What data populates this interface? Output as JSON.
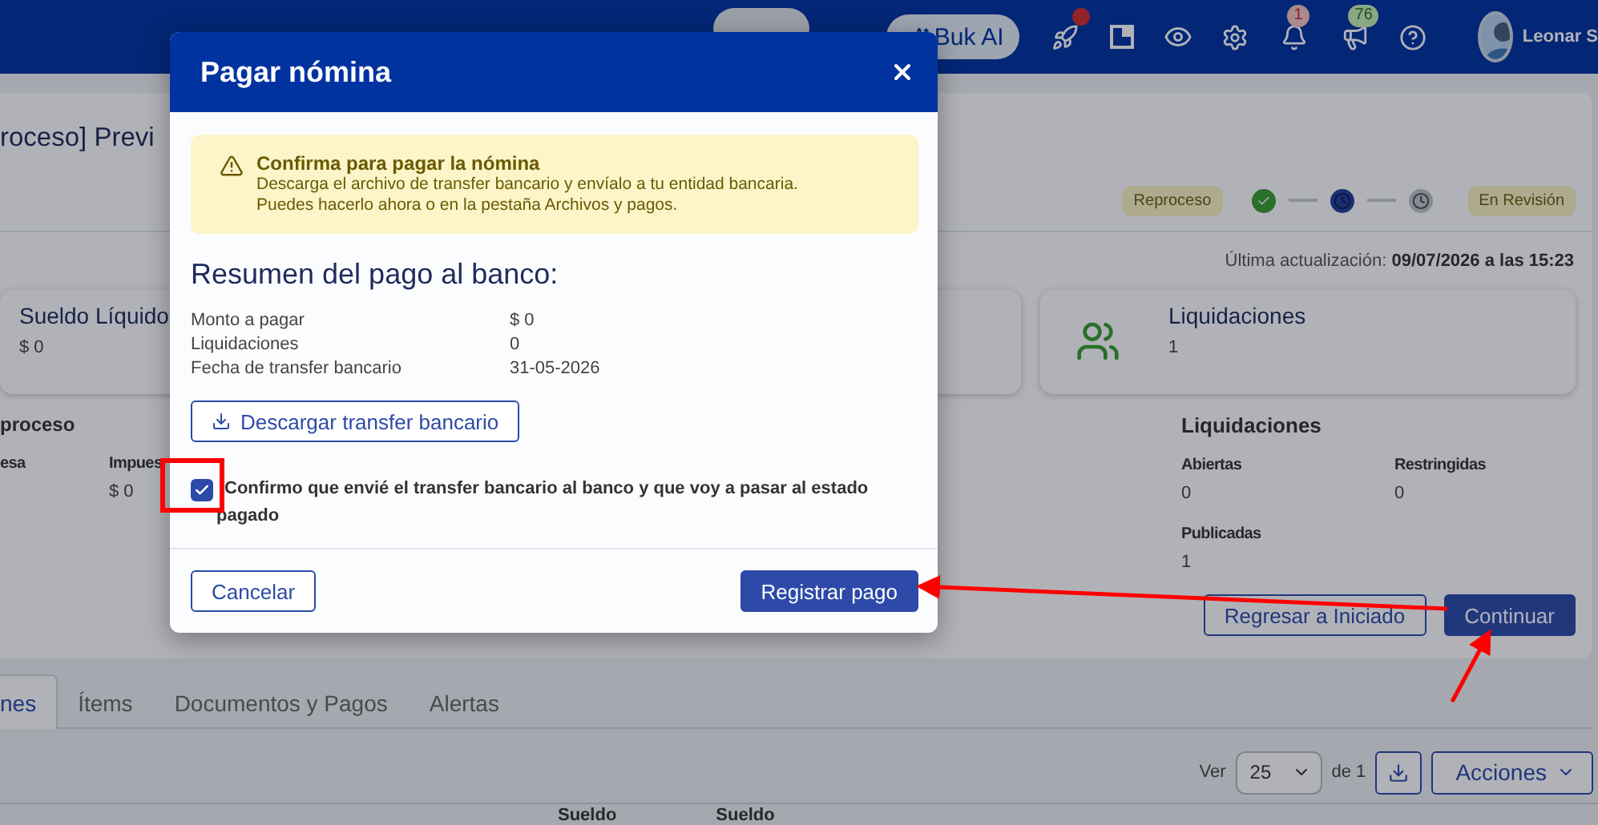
{
  "nav": {
    "ai_button": "Buk AI",
    "notifications_badge": "1",
    "messages_badge": "76",
    "user_name": "Leonar S"
  },
  "header": {
    "title": "roceso] Previ",
    "status_badge": "Reproceso",
    "steps": [
      {
        "kind": "done"
      },
      {
        "kind": "current"
      },
      {
        "kind": "pending"
      }
    ],
    "stage_badge": "En Revisión",
    "last_update_label": "Última actualización:",
    "last_update_value": "09/07/2026 a las 15:23"
  },
  "cards": [
    {
      "kind": "plain",
      "title": "Sueldo Líquido",
      "value": "$ 0"
    },
    {
      "kind": "covered"
    },
    {
      "kind": "icon",
      "title": "Liquidaciones",
      "value": "1"
    }
  ],
  "process": {
    "title": "proceso",
    "columns": [
      {
        "label": "esa"
      },
      {
        "label": "Impues",
        "value": "$ 0"
      }
    ]
  },
  "liquidaciones": {
    "title": "Liquidaciones",
    "stats": [
      {
        "label": "Abiertas",
        "value": "0"
      },
      {
        "label": "Restringidas",
        "value": "0"
      },
      {
        "label": "Publicadas",
        "value": "1"
      }
    ],
    "buttons": [
      {
        "label": "Regresar a Iniciado",
        "kind": "secondary"
      },
      {
        "label": "Continuar",
        "kind": "primary"
      }
    ]
  },
  "tabs": [
    {
      "label": "nes",
      "selected": true
    },
    {
      "label": "Ítems",
      "selected": false
    },
    {
      "label": "Documentos y Pagos",
      "selected": false
    },
    {
      "label": "Alertas",
      "selected": false
    }
  ],
  "toolbar": {
    "per_page_label": "Ver",
    "per_page": "25",
    "pages": "de 1",
    "actions": "Acciones"
  },
  "table": {
    "columns": [
      "Sueldo",
      "Sueldo"
    ]
  },
  "modal": {
    "title": "Pagar nómina",
    "alert": {
      "title": "Confirma para pagar la nómina",
      "lines": [
        "Descarga el archivo de transfer bancario y envíalo a tu entidad bancaria.",
        "Puedes hacerlo ahora o en la pestaña Archivos y pagos."
      ]
    },
    "summary_title": "Resumen del pago al banco:",
    "rows": [
      {
        "label": "Monto a pagar",
        "value": "$ 0"
      },
      {
        "label": "Liquidaciones",
        "value": "0"
      },
      {
        "label": "Fecha de transfer bancario",
        "value": "31-05-2026"
      }
    ],
    "download_button": "Descargar transfer bancario",
    "confirm": {
      "label": "Confirmo que envié el transfer bancario al banco y que voy a pasar al estado pagado",
      "checked": true
    },
    "buttons": [
      {
        "label": "Cancelar",
        "kind": "secondary"
      },
      {
        "label": "Registrar pago",
        "kind": "primary"
      }
    ]
  }
}
